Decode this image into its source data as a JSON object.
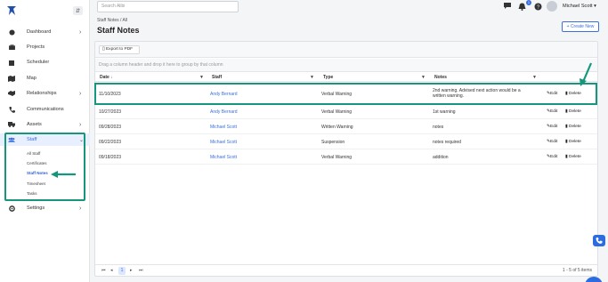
{
  "sidebar": {
    "items": [
      {
        "label": "Dashboard",
        "icon": "dashboard-icon",
        "chevron": true
      },
      {
        "label": "Projects",
        "icon": "briefcase-icon",
        "chevron": false
      },
      {
        "label": "Scheduler",
        "icon": "calendar-icon",
        "chevron": false
      },
      {
        "label": "Map",
        "icon": "map-icon",
        "chevron": false
      },
      {
        "label": "Relationships",
        "icon": "handshake-icon",
        "chevron": true
      },
      {
        "label": "Communications",
        "icon": "phone-icon",
        "chevron": false
      },
      {
        "label": "Assets",
        "icon": "truck-icon",
        "chevron": true
      },
      {
        "label": "Staff",
        "icon": "users-icon",
        "chevron": true
      },
      {
        "label": "Settings",
        "icon": "gear-icon",
        "chevron": true
      }
    ],
    "staff_sub": [
      "All Staff",
      "Certificates",
      "Staff Notes",
      "Timesheet",
      "Tasks"
    ]
  },
  "header": {
    "search_placeholder": "Search Alibi",
    "notification_count": "1",
    "user_name": "Michael Scott"
  },
  "page": {
    "breadcrumb": "Staff Notes / All",
    "title": "Staff Notes",
    "create_label": "+ Create New"
  },
  "grid": {
    "export_label": "Export to PDF",
    "group_hint": "Drag a column header and drop it here to group by that column",
    "columns": [
      "Date",
      "Staff",
      "Type",
      "Notes"
    ],
    "rows": [
      {
        "date": "11/10/2023",
        "staff": "Andy Bernard",
        "type": "Verbal Warning",
        "notes_1": "2nd warning. Advised next action would be a",
        "notes_2": "written warning."
      },
      {
        "date": "10/27/2023",
        "staff": "Andy Bernard",
        "type": "Verbal Warning",
        "notes_1": "1st warning",
        "notes_2": ""
      },
      {
        "date": "09/28/2023",
        "staff": "Michael Scott",
        "type": "Written Warning",
        "notes_1": "notes",
        "notes_2": ""
      },
      {
        "date": "09/22/2023",
        "staff": "Michael Scott",
        "type": "Suspension",
        "notes_1": "notes required",
        "notes_2": ""
      },
      {
        "date": "09/18/2023",
        "staff": "Michael Scott",
        "type": "Verbal Warning",
        "notes_1": "addition",
        "notes_2": ""
      }
    ],
    "edit_label": "Edit",
    "delete_label": "Delete",
    "pager_page": "1",
    "pager_info": "1 - 5 of 5 items"
  },
  "colors": {
    "accent": "#3b6fe0",
    "highlight": "#16967c"
  }
}
